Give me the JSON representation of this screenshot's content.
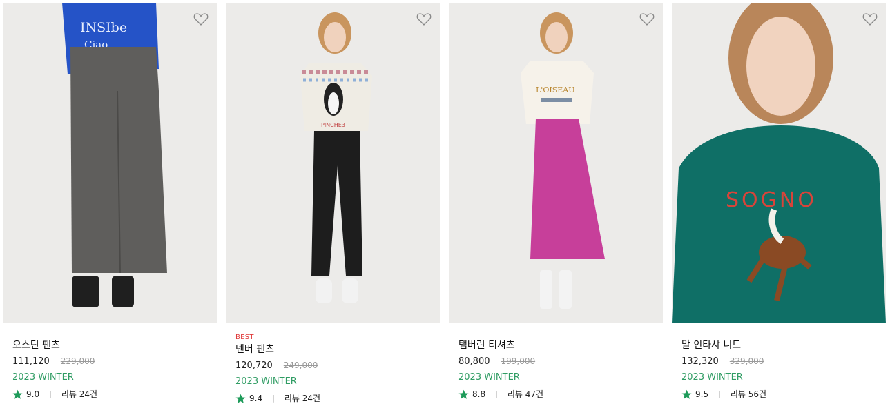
{
  "products": [
    {
      "badge": "",
      "name": "오스틴 팬츠",
      "price": "111,120",
      "original_price": "229,000",
      "season": "2023 WINTER",
      "rating": "9.0",
      "reviews": "리뷰 24건",
      "wishlist_icon": "heart-outline-icon",
      "rating_icon": "star-icon"
    },
    {
      "badge": "BEST",
      "name": "덴버 팬츠",
      "price": "120,720",
      "original_price": "249,000",
      "season": "2023 WINTER",
      "rating": "9.4",
      "reviews": "리뷰 24건",
      "wishlist_icon": "heart-outline-icon",
      "rating_icon": "star-icon"
    },
    {
      "badge": "",
      "name": "탬버린 티셔츠",
      "price": "80,800",
      "original_price": "199,000",
      "season": "2023 WINTER",
      "rating": "8.8",
      "reviews": "리뷰 47건",
      "wishlist_icon": "heart-outline-icon",
      "rating_icon": "star-icon"
    },
    {
      "badge": "",
      "name": "말 인타샤 니트",
      "price": "132,320",
      "original_price": "329,000",
      "season": "2023 WINTER",
      "rating": "9.5",
      "reviews": "리뷰 56건",
      "wishlist_icon": "heart-outline-icon",
      "rating_icon": "star-icon"
    }
  ],
  "image_text": {
    "sweater_print_1": "INSIbe",
    "sweater_print_2": "Ciao",
    "penguin_print": "PINCHE3",
    "tshirt_print": "L'OISEAU",
    "knit_print": "SOGNO"
  },
  "colors": {
    "season_green": "#2f9c63",
    "star_green": "#1e9b5a",
    "badge_red": "#e03a3a",
    "strike_gray": "#9a9a9a"
  }
}
